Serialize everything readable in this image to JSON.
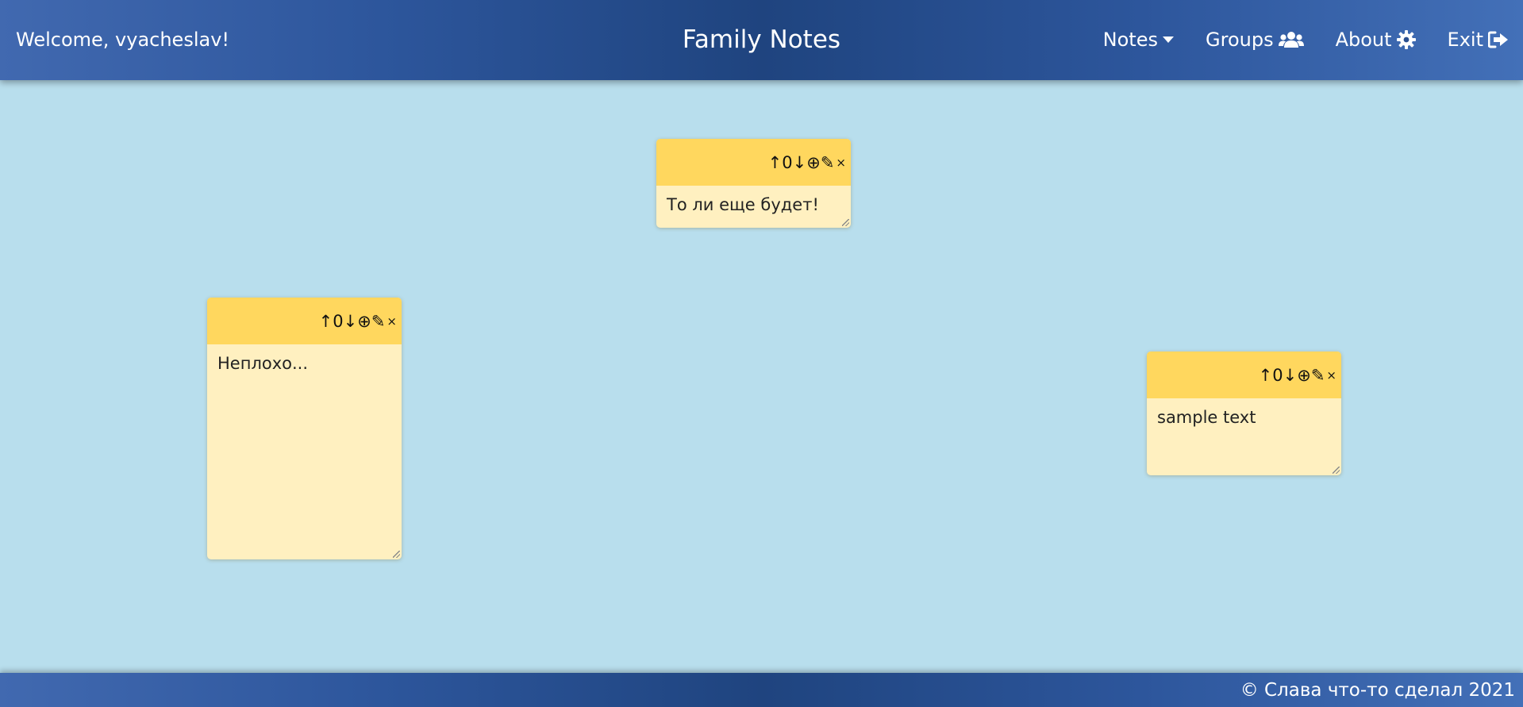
{
  "header": {
    "welcome": "Welcome, vyacheslav!",
    "title": "Family Notes",
    "nav": {
      "notes": "Notes",
      "groups": "Groups",
      "about": "About",
      "exit": "Exit"
    }
  },
  "notes": [
    {
      "text": "То ли еще будет!",
      "controls": {
        "up": "↑",
        "score": "0",
        "down": "↓",
        "add": "⊕",
        "edit": "✎",
        "close": "×"
      }
    },
    {
      "text": "Неплохо...",
      "controls": {
        "up": "↑",
        "score": "0",
        "down": "↓",
        "add": "⊕",
        "edit": "✎",
        "close": "×"
      }
    },
    {
      "text": "sample text",
      "controls": {
        "up": "↑",
        "score": "0",
        "down": "↓",
        "add": "⊕",
        "edit": "✎",
        "close": "×"
      }
    }
  ],
  "footer": {
    "copyright": "© Слава что-то сделал 2021"
  },
  "colors": {
    "background": "#b8deed",
    "bar_dark": "#1f447f",
    "bar_light": "#4370b8",
    "note_header": "#ffd75e",
    "note_body": "#fff0c0"
  }
}
